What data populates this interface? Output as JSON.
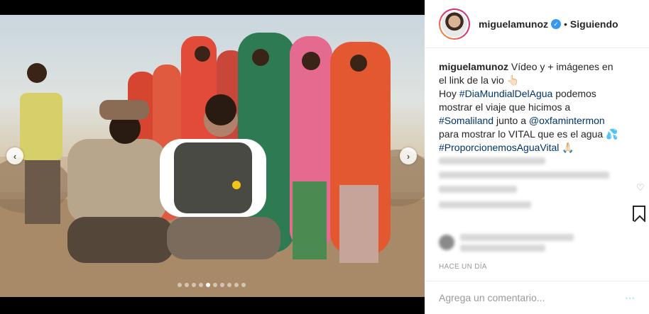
{
  "post": {
    "username": "miguelamunoz",
    "follow_status": "Siguiendo",
    "caption_user": "miguelamunoz",
    "caption_line1": " Vídeo y + imágenes en el link de la vio 👆🏻",
    "caption_line2a": "Hoy ",
    "tag_day": "#DiaMundialDelAgua",
    "caption_line2b": " podemos mostrar el viaje que hicimos a ",
    "tag_place": "#Somaliland",
    "caption_line2c": " junto a ",
    "mention": "@oxfamintermon",
    "caption_line2d": " para mostrar lo VITAL que es el agua 💦 ",
    "tag_campaign": "#ProporcionemosAguaVital",
    "caption_end": " 🙏🏻",
    "time_ago": "HACE UN DÍA",
    "comment_placeholder": "Agrega un comentario..."
  },
  "carousel": {
    "dot_count": 10,
    "active_index": 4,
    "prev_icon": "chevron-left-icon",
    "next_icon": "chevron-right-icon"
  },
  "colors": {
    "verified": "#3897f0",
    "hashtag": "#003569",
    "text": "#262626",
    "muted": "#999999"
  }
}
